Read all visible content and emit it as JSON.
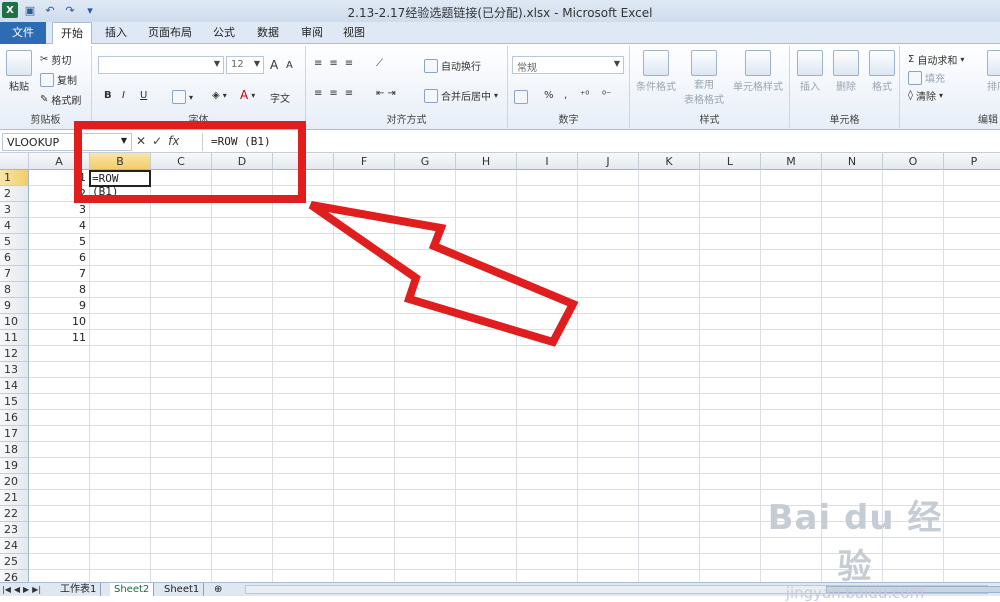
{
  "window": {
    "title": "2.13-2.17经验选题链接(已分配).xlsx  -  Microsoft Excel",
    "qat_icons": [
      "excel-logo",
      "save-icon",
      "undo-icon",
      "redo-icon",
      "customize-icon"
    ]
  },
  "tabs": [
    {
      "label": "文件",
      "active": false
    },
    {
      "label": "开始",
      "active": true
    },
    {
      "label": "插入",
      "active": false
    },
    {
      "label": "页面布局",
      "active": false
    },
    {
      "label": "公式",
      "active": false
    },
    {
      "label": "数据",
      "active": false
    },
    {
      "label": "审阅",
      "active": false
    },
    {
      "label": "视图",
      "active": false
    }
  ],
  "ribbon": {
    "clipboard": {
      "group": "剪贴板",
      "paste": "粘贴",
      "cut": "剪切",
      "copy": "复制",
      "format_painter": "格式刷"
    },
    "font": {
      "group": "字体",
      "name_value": "",
      "size_value": "12",
      "bold": "B",
      "italic": "I",
      "underline": "U",
      "grow": "A",
      "shrink": "A",
      "font_color": "A",
      "change_case": "字文"
    },
    "alignment": {
      "group": "对齐方式",
      "wrap": "自动换行",
      "merge": "合并后居中"
    },
    "number": {
      "group": "数字",
      "format_value": "常规",
      "percent": "%"
    },
    "styles": {
      "group": "样式",
      "conditional": "条件格式",
      "table_line1": "套用",
      "table_line2": "表格格式",
      "cell_styles": "单元格样式"
    },
    "cells": {
      "group": "单元格",
      "insert": "插入",
      "delete": "删除",
      "format": "格式"
    },
    "editing": {
      "group": "编辑",
      "autosum": "自动求和",
      "fill": "填充",
      "clear": "清除",
      "sort": "排序"
    }
  },
  "formula_bar": {
    "name_box": "VLOOKUP",
    "cancel": "✕",
    "enter": "✓",
    "fx": "fx",
    "content": "=ROW (B1)"
  },
  "columns": [
    "A",
    "B",
    "C",
    "D",
    "E",
    "F",
    "G",
    "H",
    "I",
    "J",
    "K",
    "L",
    "M",
    "N",
    "O",
    "P"
  ],
  "rows": [
    "1",
    "2",
    "3",
    "4",
    "5",
    "6",
    "7",
    "8",
    "9",
    "10",
    "11",
    "12",
    "13",
    "14",
    "15",
    "16",
    "17",
    "18",
    "19",
    "20",
    "21",
    "22",
    "23",
    "24",
    "25",
    "26"
  ],
  "cells_A": [
    "1",
    "2",
    "3",
    "4",
    "5",
    "6",
    "7",
    "8",
    "9",
    "10",
    "11"
  ],
  "active_cell": {
    "ref": "B1",
    "content": "=ROW (B1)"
  },
  "sheets": [
    {
      "label": "工作表1",
      "active": false
    },
    {
      "label": "Sheet2",
      "active": true
    },
    {
      "label": "Sheet1",
      "active": false
    }
  ],
  "watermark": {
    "main": "Bai du 经验",
    "sub": "jingyan.baidu.com"
  },
  "colors": {
    "file_tab": "#2d6bb3",
    "annotation": "#e01e1e",
    "selected_header": "#f2cd6a"
  }
}
